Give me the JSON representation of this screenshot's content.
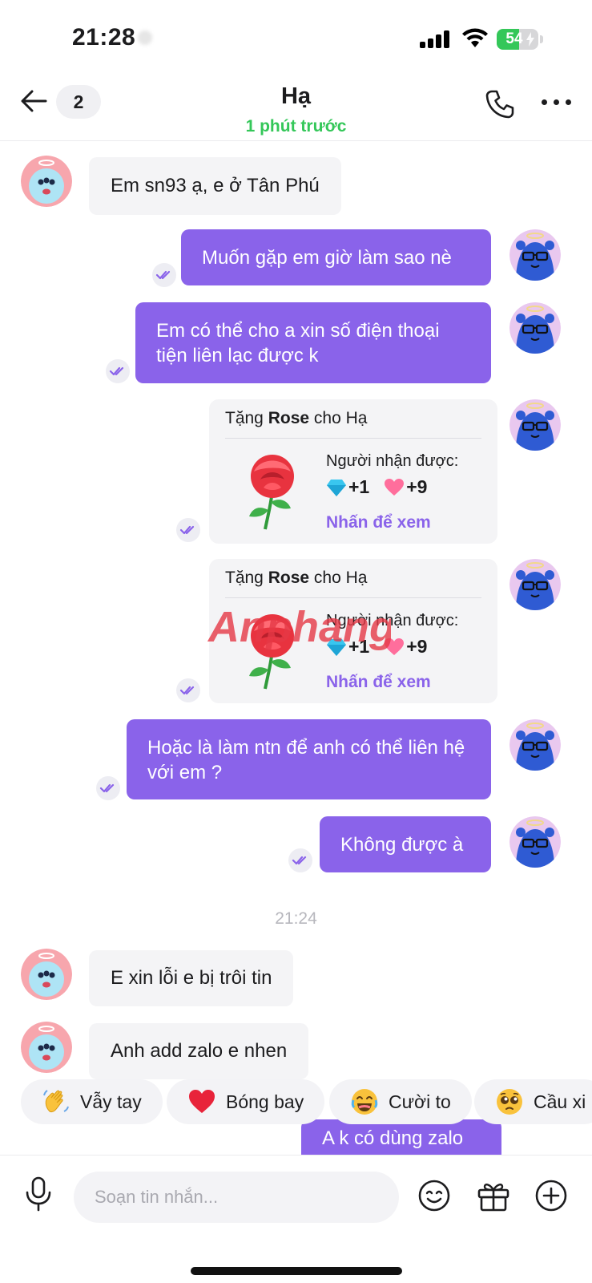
{
  "status_bar": {
    "time": "21:28",
    "battery": "54",
    "battery_level": 0.54
  },
  "header": {
    "unread_count": "2",
    "contact_name": "Hạ",
    "last_seen": "1 phút trước"
  },
  "messages": [
    {
      "direction": "in",
      "text": "Em sn93 ạ, e ở Tân Phú"
    },
    {
      "direction": "out",
      "text": "Muốn gặp em giờ làm sao nè"
    },
    {
      "direction": "out",
      "text": "Em có thể cho a xin số điện thoại tiện liên lạc được k"
    },
    {
      "direction": "out",
      "type": "gift",
      "prefix": "Tặng",
      "gift_name": "Rose",
      "suffix": "cho Hạ",
      "receive_label": "Người nhận được:",
      "diamonds": "+1",
      "hearts": "+9",
      "view_label": "Nhấn để xem"
    },
    {
      "direction": "out",
      "type": "gift",
      "prefix": "Tặng",
      "gift_name": "Rose",
      "suffix": "cho Hạ",
      "receive_label": "Người nhận được:",
      "diamonds": "+1",
      "hearts": "+9",
      "view_label": "Nhấn để xem"
    },
    {
      "direction": "out",
      "text": "Hoặc là làm ntn để anh có thể liên hệ với em ?"
    },
    {
      "direction": "out",
      "text": "Không được à"
    },
    {
      "type": "time_divider",
      "text": "21:24"
    },
    {
      "direction": "in",
      "text": "E xin lỗi e bị trôi tin"
    },
    {
      "direction": "in",
      "text": "Anh add zalo e nhen"
    },
    {
      "direction": "out",
      "text": "A k có dùng zalo"
    }
  ],
  "watermark": "Anphang",
  "quick_reactions": [
    {
      "label": "Vẫy tay",
      "icon": "waving-hand-icon"
    },
    {
      "label": "Bóng bay",
      "icon": "heart-icon"
    },
    {
      "label": "Cười to",
      "icon": "laughing-face-icon"
    },
    {
      "label": "Cầu xi",
      "icon": "pleading-face-icon"
    }
  ],
  "composer": {
    "placeholder": "Soạn tin nhắn..."
  },
  "colors": {
    "accent": "#8a63ea",
    "online": "#34c759",
    "incoming_bubble": "#f4f4f6"
  }
}
